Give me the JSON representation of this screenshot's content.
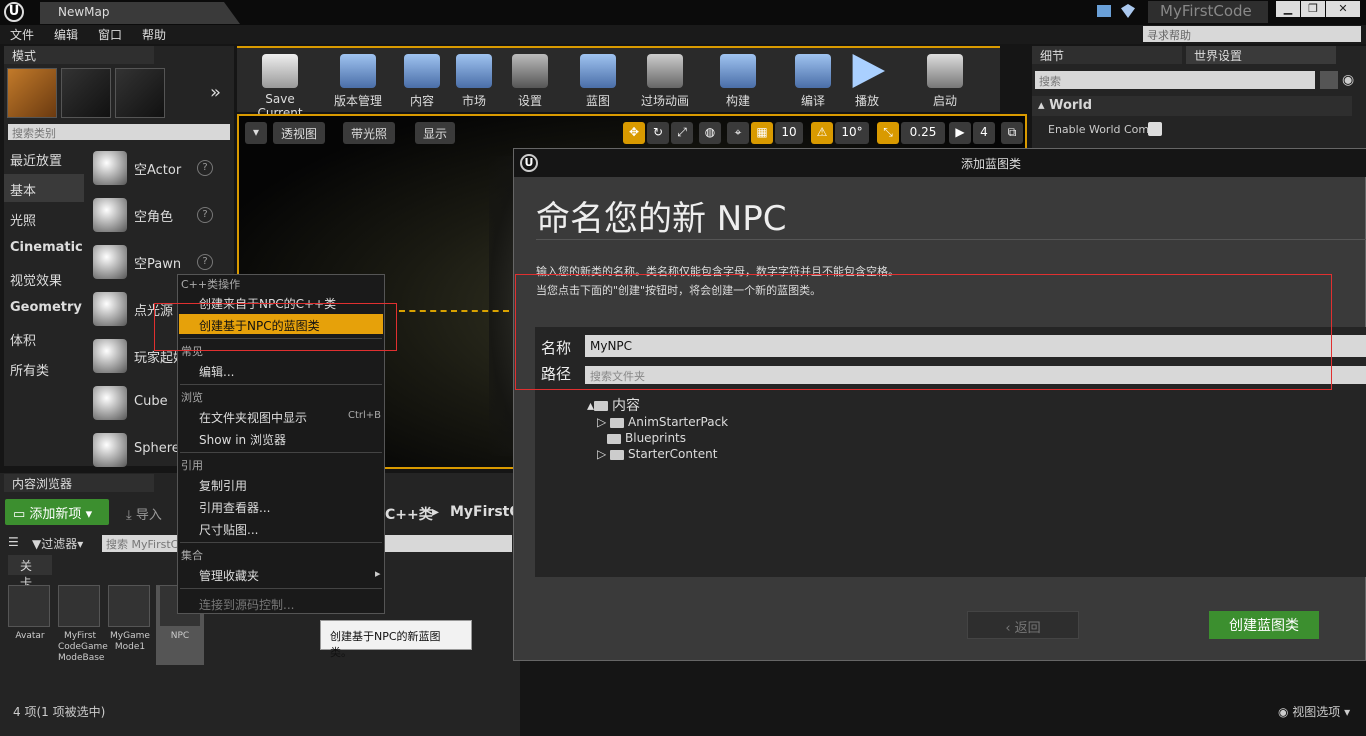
{
  "title_bar": {
    "map_tab": "NewMap",
    "project": "MyFirstCode",
    "win_min": "▁",
    "win_max": "❐",
    "win_close": "✕"
  },
  "menu": {
    "items": [
      "文件",
      "编辑",
      "窗口",
      "帮助"
    ],
    "help_placeholder": "寻求帮助"
  },
  "modes": {
    "tab": "模式",
    "search_placeholder": "搜索类别",
    "categories": [
      "最近放置",
      "基本",
      "光照",
      "Cinematic",
      "视觉效果",
      "Geometry",
      "体积",
      "所有类"
    ],
    "assets": [
      "空Actor",
      "空角色",
      "空Pawn",
      "点光源",
      "玩家起始",
      "Cube",
      "Sphere"
    ]
  },
  "toolbar": {
    "buttons": [
      "Save Current",
      "版本管理",
      "内容",
      "市场",
      "设置",
      "蓝图",
      "过场动画",
      "构建",
      "编译",
      "播放",
      "启动"
    ]
  },
  "viewport": {
    "perspective": "透视图",
    "lit": "带光照",
    "show": "显示",
    "grid": "10",
    "rot": "10°",
    "scale": "0.25",
    "cam": "4"
  },
  "details": {
    "tab1": "细节",
    "tab2": "世界设置",
    "search_placeholder": "搜索",
    "section": "World",
    "prop": "Enable World Comp"
  },
  "content_browser": {
    "tab": "内容浏览器",
    "add_new": "添加新项",
    "import": "导入",
    "filter": "过滤器",
    "search_placeholder": "搜索 MyFirstC",
    "path1": "C++类",
    "path2": "MyFirstC",
    "level_tab": "关卡",
    "assets": [
      "Avatar",
      "MyFirst CodeGame ModeBase",
      "MyGame Mode1",
      "NPC"
    ],
    "status": "4 项(1 项被选中)",
    "view_options": "视图选项"
  },
  "context_menu": {
    "h1": "C++类操作",
    "i1": "创建来自于NPC的C++类",
    "i2": "创建基于NPC的蓝图类",
    "h2": "常见",
    "i3": "编辑...",
    "h3": "浏览",
    "i4": "在文件夹视图中显示",
    "i4_shortcut": "Ctrl+B",
    "i5": "Show in 浏览器",
    "h4": "引用",
    "i6": "复制引用",
    "i7": "引用查看器...",
    "i8": "尺寸贴图...",
    "h5": "集合",
    "i9": "管理收藏夹",
    "i10": "连接到源码控制..."
  },
  "tooltip": "创建基于NPC的新蓝图类。",
  "dialog": {
    "title": "添加蓝图类",
    "heading": "命名您的新 NPC",
    "line1": "输入您的新类的名称。类名称仅能包含字母，数字字符并且不能包含空格。",
    "line2": "当您点击下面的\"创建\"按钮时，将会创建一个新的蓝图类。",
    "name_label": "名称",
    "name_value": "MyNPC",
    "path_label": "路径",
    "path_placeholder": "搜索文件夹",
    "tree_root": "内容",
    "tree_items": [
      "AnimStarterPack",
      "Blueprints",
      "StarterContent"
    ],
    "back": "‹ 返回",
    "create": "创建蓝图类"
  },
  "colors": {
    "accent": "#e6a10a",
    "green": "#3c8f2f",
    "highlight_box": "#e03030"
  }
}
